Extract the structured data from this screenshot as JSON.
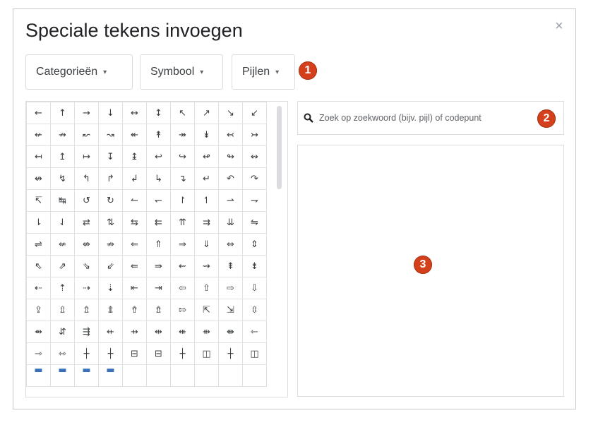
{
  "dialog": {
    "title": "Speciale tekens invoegen",
    "close": "×"
  },
  "dropdowns": {
    "category": "Categorieën",
    "subcategory": "Symbool",
    "type": "Pijlen",
    "caret": "▾"
  },
  "badges": {
    "one": "1",
    "two": "2",
    "three": "3"
  },
  "search": {
    "placeholder": "Zoek op zoekwoord (bijv. pijl) of codepunt",
    "value": ""
  },
  "symbols": [
    [
      "←",
      "↑",
      "→",
      "↓",
      "↔",
      "↕",
      "↖",
      "↗",
      "↘",
      "↙"
    ],
    [
      "↚",
      "↛",
      "↜",
      "↝",
      "↞",
      "↟",
      "↠",
      "↡",
      "↢",
      "↣"
    ],
    [
      "↤",
      "↥",
      "↦",
      "↧",
      "↨",
      "↩",
      "↪",
      "↫",
      "↬",
      "↭"
    ],
    [
      "↮",
      "↯",
      "↰",
      "↱",
      "↲",
      "↳",
      "↴",
      "↵",
      "↶",
      "↷"
    ],
    [
      "↸",
      "↹",
      "↺",
      "↻",
      "↼",
      "↽",
      "↾",
      "↿",
      "⇀",
      "⇁"
    ],
    [
      "⇂",
      "⇃",
      "⇄",
      "⇅",
      "⇆",
      "⇇",
      "⇈",
      "⇉",
      "⇊",
      "⇋"
    ],
    [
      "⇌",
      "⇍",
      "⇎",
      "⇏",
      "⇐",
      "⇑",
      "⇒",
      "⇓",
      "⇔",
      "⇕"
    ],
    [
      "⇖",
      "⇗",
      "⇘",
      "⇙",
      "⇚",
      "⇛",
      "⇜",
      "⇝",
      "⇞",
      "⇟"
    ],
    [
      "⇠",
      "⇡",
      "⇢",
      "⇣",
      "⇤",
      "⇥",
      "⇦",
      "⇧",
      "⇨",
      "⇩"
    ],
    [
      "⇪",
      "⇫",
      "⇬",
      "⇭",
      "⇮",
      "⇯",
      "⇰",
      "⇱",
      "⇲",
      "⇳"
    ],
    [
      "⇴",
      "⇵",
      "⇶",
      "⇷",
      "⇸",
      "⇹",
      "⇺",
      "⇻",
      "⇼",
      "⇽"
    ],
    [
      "⇾",
      "⇿",
      "┼",
      "┼",
      "⊟",
      "⊟",
      "┼",
      "◫",
      "┼",
      "◫"
    ],
    [
      "▬",
      "▬",
      "▬",
      "▬",
      "",
      "",
      "",
      "",
      "",
      ""
    ]
  ],
  "colors": {
    "badge": "#d4401c",
    "border": "#dadce0",
    "text": "#202124"
  }
}
